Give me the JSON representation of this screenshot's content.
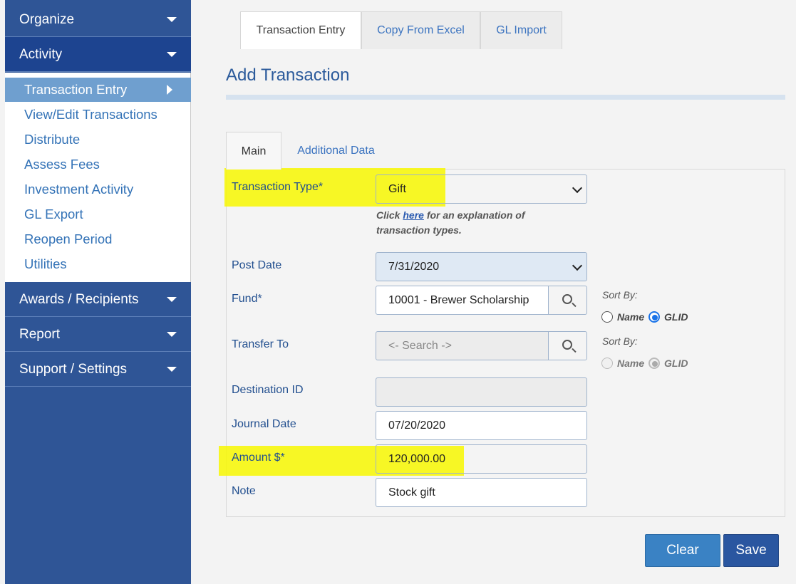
{
  "sidebar": {
    "menus": [
      {
        "label": "Organize"
      },
      {
        "label": "Activity"
      },
      {
        "label": "Awards / Recipients"
      },
      {
        "label": "Report"
      },
      {
        "label": "Support / Settings"
      }
    ],
    "activity_items": [
      {
        "label": "Transaction Entry"
      },
      {
        "label": "View/Edit Transactions"
      },
      {
        "label": "Distribute"
      },
      {
        "label": "Assess Fees"
      },
      {
        "label": "Investment Activity"
      },
      {
        "label": "GL Export"
      },
      {
        "label": "Reopen Period"
      },
      {
        "label": "Utilities"
      }
    ]
  },
  "top_tabs": [
    {
      "label": "Transaction Entry"
    },
    {
      "label": "Copy From Excel"
    },
    {
      "label": "GL Import"
    }
  ],
  "page_title": "Add Transaction",
  "inner_tabs": [
    {
      "label": "Main"
    },
    {
      "label": "Additional Data"
    }
  ],
  "form": {
    "transaction_type": {
      "label": "Transaction Type*",
      "value": "Gift"
    },
    "hint": {
      "prefix": "Click ",
      "link": "here",
      "suffix": " for an explanation of transaction types."
    },
    "post_date": {
      "label": "Post Date",
      "value": "7/31/2020"
    },
    "fund": {
      "label": "Fund*",
      "value": "10001 - Brewer Scholarship"
    },
    "transfer_to": {
      "label": "Transfer To",
      "placeholder": "<- Search ->"
    },
    "destination_id": {
      "label": "Destination ID",
      "value": ""
    },
    "journal_date": {
      "label": "Journal Date",
      "value": "07/20/2020"
    },
    "amount": {
      "label": "Amount $*",
      "value": "120,000.00"
    },
    "note": {
      "label": "Note",
      "value": "Stock gift"
    },
    "sort_by": {
      "label": "Sort By:",
      "option_name": "Name",
      "option_glid": "GLID"
    }
  },
  "buttons": {
    "clear": "Clear",
    "save": "Save"
  },
  "colors": {
    "sidebar": "#2f5596",
    "highlight": "#f7f700",
    "link": "#3473b7"
  }
}
